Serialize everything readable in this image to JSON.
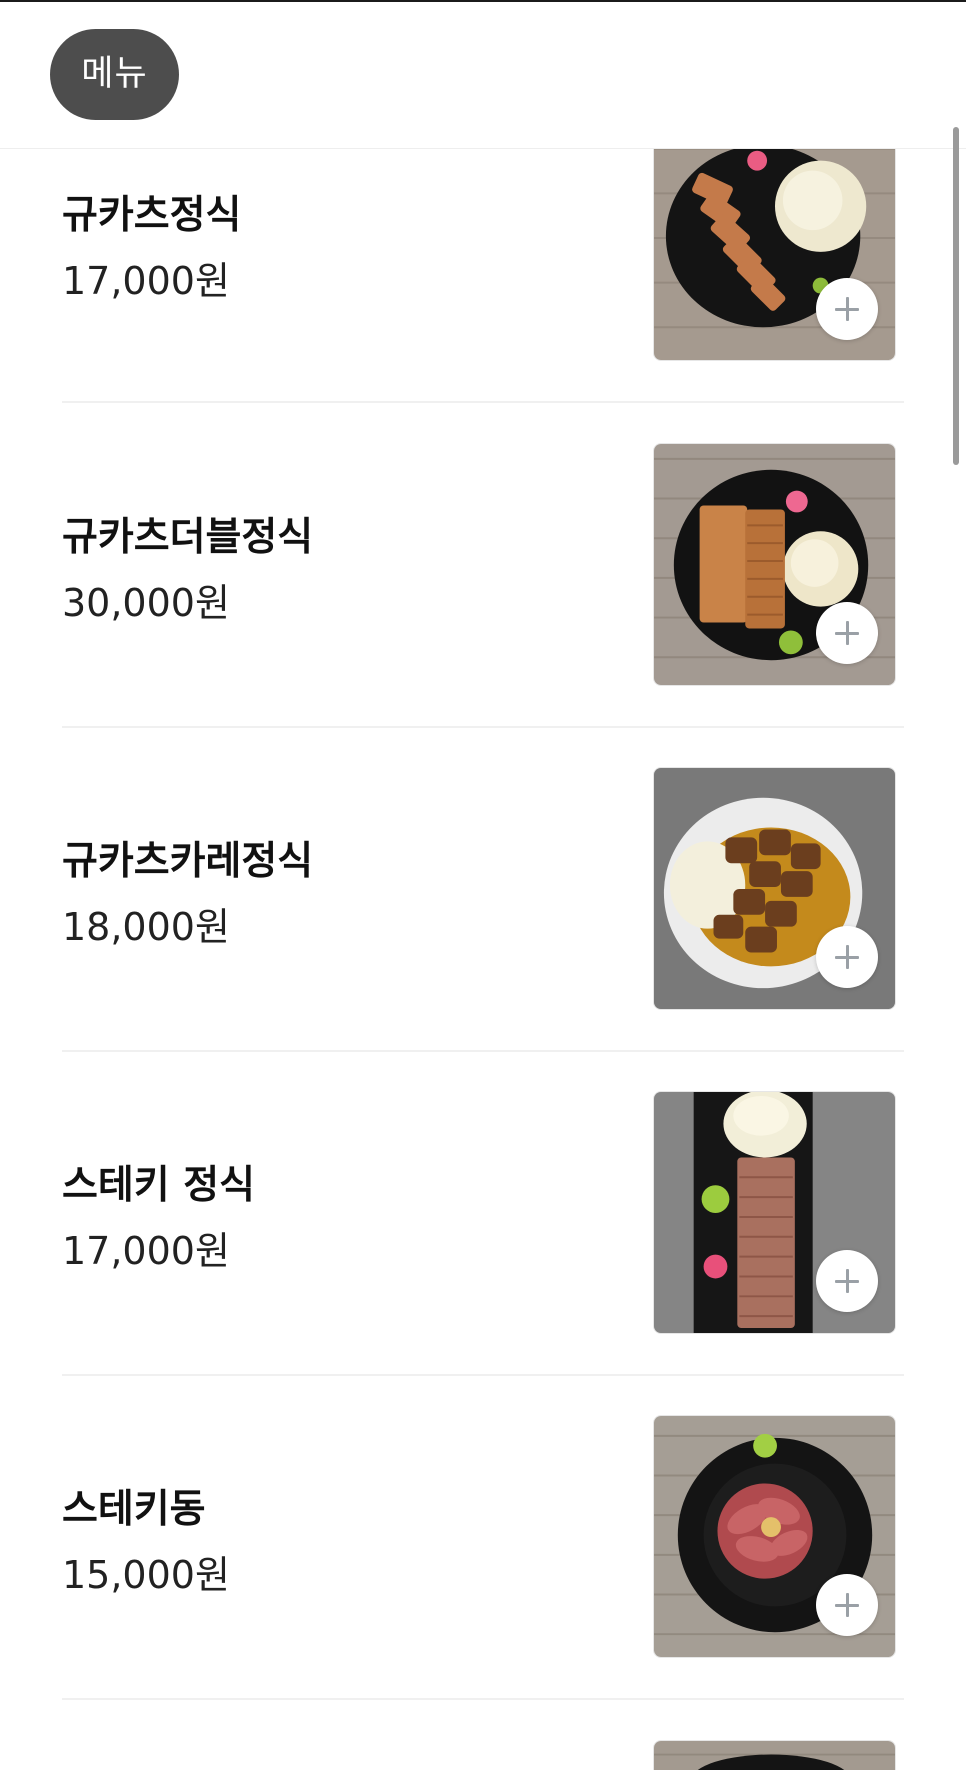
{
  "header": {
    "menu_label": "메뉴"
  },
  "items": [
    {
      "name": "규카츠정식",
      "price": "17,000원"
    },
    {
      "name": "규카츠더블정식",
      "price": "30,000원"
    },
    {
      "name": "규카츠카레정식",
      "price": "18,000원"
    },
    {
      "name": "스테키 정식",
      "price": "17,000원"
    },
    {
      "name": "스테키동",
      "price": "15,000원"
    }
  ],
  "colors": {
    "header_pill": "#4d4d4d",
    "divider": "#f0f0f0",
    "add_button_plus": "#9aa0a6"
  },
  "icons": {
    "add": "plus-icon"
  }
}
